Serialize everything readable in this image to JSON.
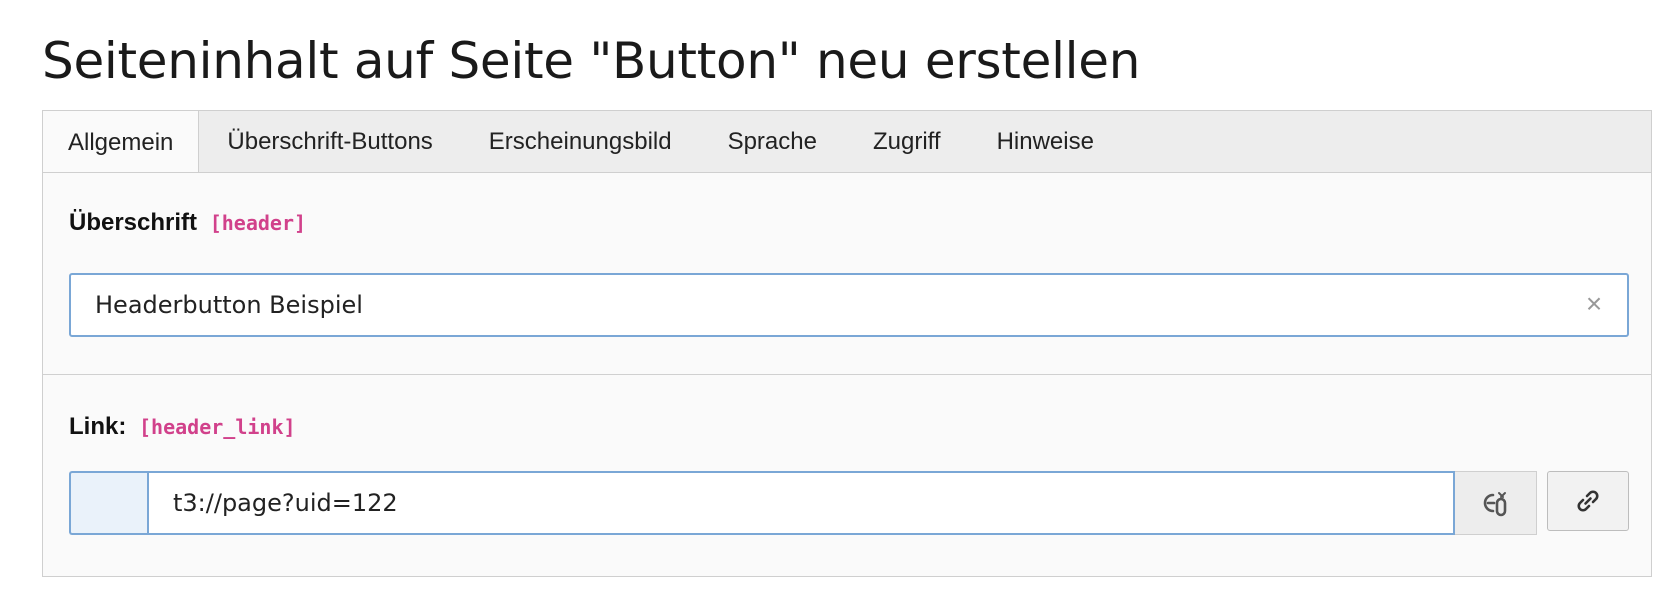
{
  "page": {
    "title": "Seiteninhalt auf Seite \"Button\" neu erstellen"
  },
  "tabs": [
    {
      "label": "Allgemein",
      "active": true
    },
    {
      "label": "Überschrift-Buttons",
      "active": false
    },
    {
      "label": "Erscheinungsbild",
      "active": false
    },
    {
      "label": "Sprache",
      "active": false
    },
    {
      "label": "Zugriff",
      "active": false
    },
    {
      "label": "Hinweise",
      "active": false
    }
  ],
  "fields": {
    "header": {
      "label": "Überschrift",
      "key": "[header]",
      "value": "Headerbutton Beispiel",
      "clear_symbol": "×"
    },
    "header_link": {
      "label": "Link:",
      "key": "[header_link]",
      "value": "t3://page?uid=122",
      "unlink_icon": "unlink-icon",
      "link_icon": "link-icon"
    }
  },
  "colors": {
    "field_key": "#d1418b",
    "input_border": "#7aa7d6",
    "tab_bar": "#ededed"
  }
}
